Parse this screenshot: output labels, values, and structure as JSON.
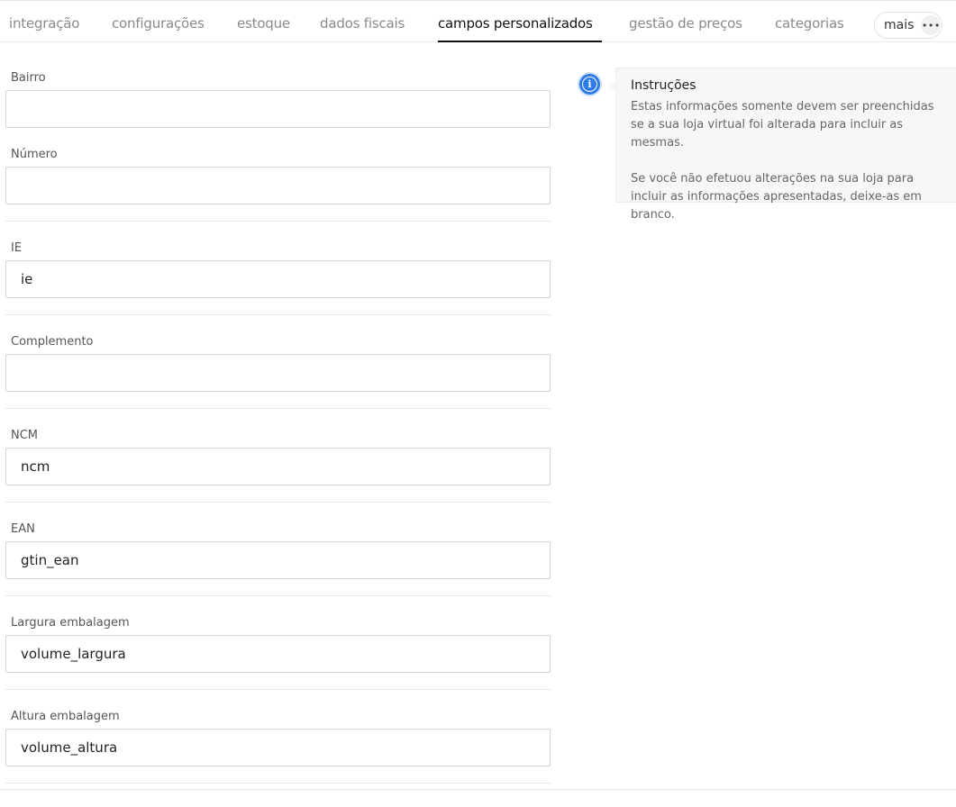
{
  "tabs": [
    {
      "label": "integração"
    },
    {
      "label": "configurações"
    },
    {
      "label": "estoque"
    },
    {
      "label": "dados fiscais"
    },
    {
      "label": "campos personalizados",
      "active": true
    },
    {
      "label": "gestão de preços"
    },
    {
      "label": "categorias"
    }
  ],
  "more": {
    "label": "mais",
    "icon": "more-horizontal-icon"
  },
  "fields": [
    {
      "label": "Bairro",
      "value": ""
    },
    {
      "label": "Número",
      "value": ""
    },
    {
      "label": "IE",
      "value": "ie"
    },
    {
      "label": "Complemento",
      "value": ""
    },
    {
      "label": "NCM",
      "value": "ncm"
    },
    {
      "label": "EAN",
      "value": "gtin_ean"
    },
    {
      "label": "Largura embalagem",
      "value": "volume_largura"
    },
    {
      "label": "Altura embalagem",
      "value": "volume_altura"
    }
  ],
  "info": {
    "icon": "info-icon",
    "title": "Instruções",
    "paragraph1": "Estas informações somente devem ser preenchidas se a sua loja virtual foi alterada para incluir as mesmas.",
    "paragraph2": "Se você não efetuou alterações na sua loja para incluir as informações apresentadas, deixe-as em branco."
  },
  "colors": {
    "accent": "#2d7be8",
    "active_tab": "#111111",
    "inactive_tab": "#8a8a8a"
  }
}
